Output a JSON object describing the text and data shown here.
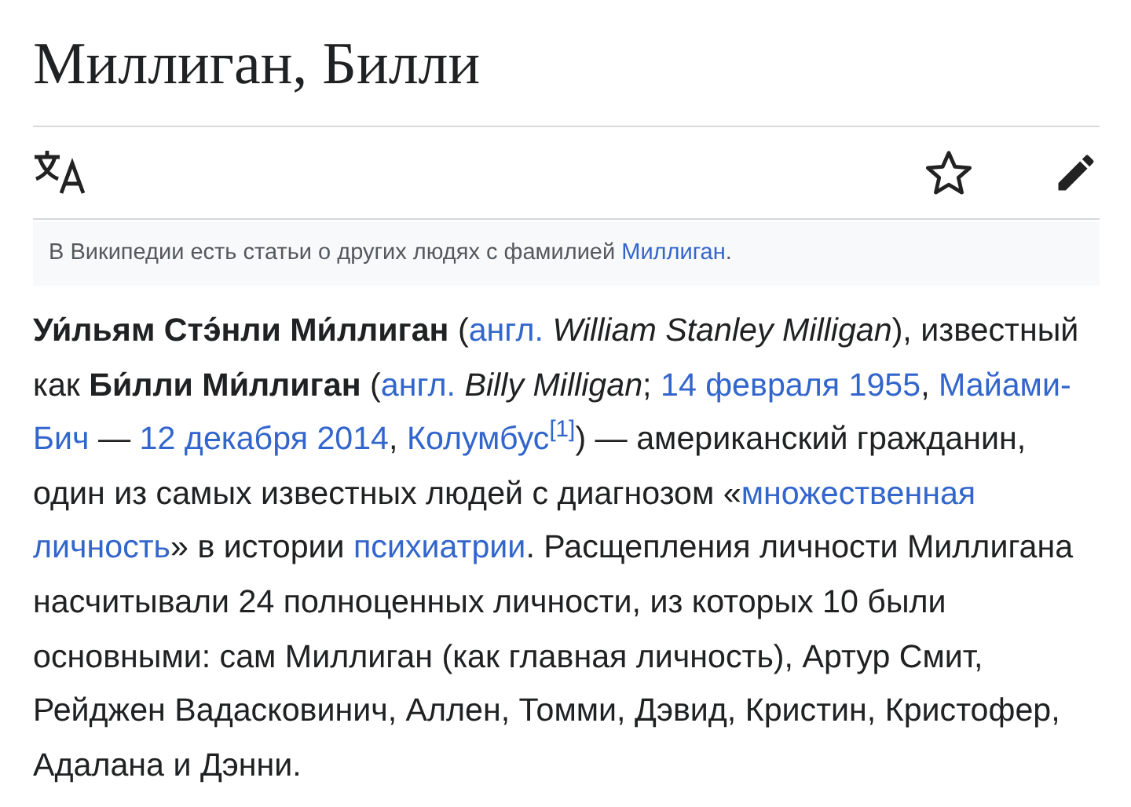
{
  "page_title": "Миллиган, Билли",
  "toolbar": [
    {
      "kind": "language"
    },
    {
      "kind": "spacer"
    },
    {
      "kind": "watch"
    },
    {
      "kind": "edit"
    }
  ],
  "hatnote": [
    {
      "kind": "text",
      "text": "В Википедии есть статьи о других людях с фамилией "
    },
    {
      "kind": "link",
      "text": "Миллиган"
    },
    {
      "kind": "text",
      "text": "."
    }
  ],
  "paragraph": [
    {
      "kind": "text",
      "text": "**Уи́льям Стэ́нли Ми́ллиган** ("
    },
    {
      "kind": "link",
      "text": "англ."
    },
    {
      "kind": "text",
      "text": " *William Stanley Milligan*), известный как **Би́лли Ми́ллиган** ("
    },
    {
      "kind": "link",
      "text": "англ."
    },
    {
      "kind": "text",
      "text": " *Billy Milligan*; "
    },
    {
      "kind": "link",
      "text": "14 февраля 1955"
    },
    {
      "kind": "text",
      "text": ", "
    },
    {
      "kind": "link",
      "text": "Майами-"
    },
    {
      "kind": "link_cont",
      "text": "Бич"
    },
    {
      "kind": "text",
      "text": " — "
    },
    {
      "kind": "link",
      "text": "12 декабря 2014"
    },
    {
      "kind": "text",
      "text": ", "
    },
    {
      "kind": "link",
      "text": "Колумбус"
    },
    {
      "kind": "ref",
      "text": "[1]"
    },
    {
      "kind": "text",
      "text": ") — американский гражданин, один из самых известных людей с диагнозом «"
    },
    {
      "kind": "link",
      "text": "множественная"
    },
    {
      "kind": "link",
      "text": "личность"
    },
    {
      "kind": "text",
      "text": "» в истории "
    },
    {
      "kind": "link",
      "text": "психиатрии"
    },
    {
      "kind": "text",
      "text": ". Расщепления личности Миллигана насчитывали 24 полноценных личности, из которых 10 были основными: сам Миллиган (как главная личность), Артур Смит, Рейджен Вадасковинич, Аллен, Томми, Дэвид, Кристин, Кристофер, Адалана и Дэнни."
    }
  ]
}
